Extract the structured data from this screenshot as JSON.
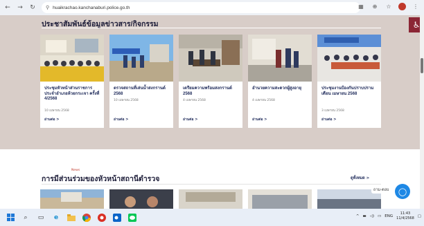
{
  "browser": {
    "url": "huaikrachao.kanchanaburi.police.go.th",
    "back_icon": "arrow-left-icon",
    "forward_icon": "arrow-right-icon",
    "reload_icon": "reload-icon"
  },
  "section1": {
    "title": "ประชาสัมพันธ์ข้อมูลข่าวสาร/กิจกรรม",
    "background": "#d8cdc8",
    "cards": [
      {
        "title": "ประชุมหัวหน้าส่วนราชการประจำอำเภอห้วยกระเจา ครั้งที่ 4/2568",
        "date": "10 เมษายน 2568",
        "more": "อ่านต่อ >"
      },
      {
        "title": "ตรวจสถานที่เล่นน้ำสงกรานต์ 2568",
        "date": "10 เมษายน 2568",
        "more": "อ่านต่อ >"
      },
      {
        "title": "เตรียมความพร้อมสงกรานต์ 2568",
        "date": "4 เมษายน 2568",
        "more": "อ่านต่อ >"
      },
      {
        "title": "อำนวยความสะดวกผู้สูงอายุ",
        "date": "4 เมษายน 2568",
        "more": "อ่านต่อ >"
      },
      {
        "title": "ประชุมงานป้องกันปราบปราม เดือน เมษายน 2568",
        "date": "3 เมษายน 2568",
        "more": "อ่านต่อ >"
      }
    ]
  },
  "section2": {
    "tag": "News",
    "title": "การมีส่วนร่วมของหัวหน้าสถานีตำรวจ",
    "view_all": "ดูทั้งหมด >",
    "chat_label": "ถาม-ตอบ"
  },
  "taskbar": {
    "lang": "ENG",
    "time": "11:43",
    "date": "11/4/2568"
  },
  "colors": {
    "accent": "#1e2a5a",
    "accessibility": "#8b2635",
    "chat": "#1e88e5"
  }
}
